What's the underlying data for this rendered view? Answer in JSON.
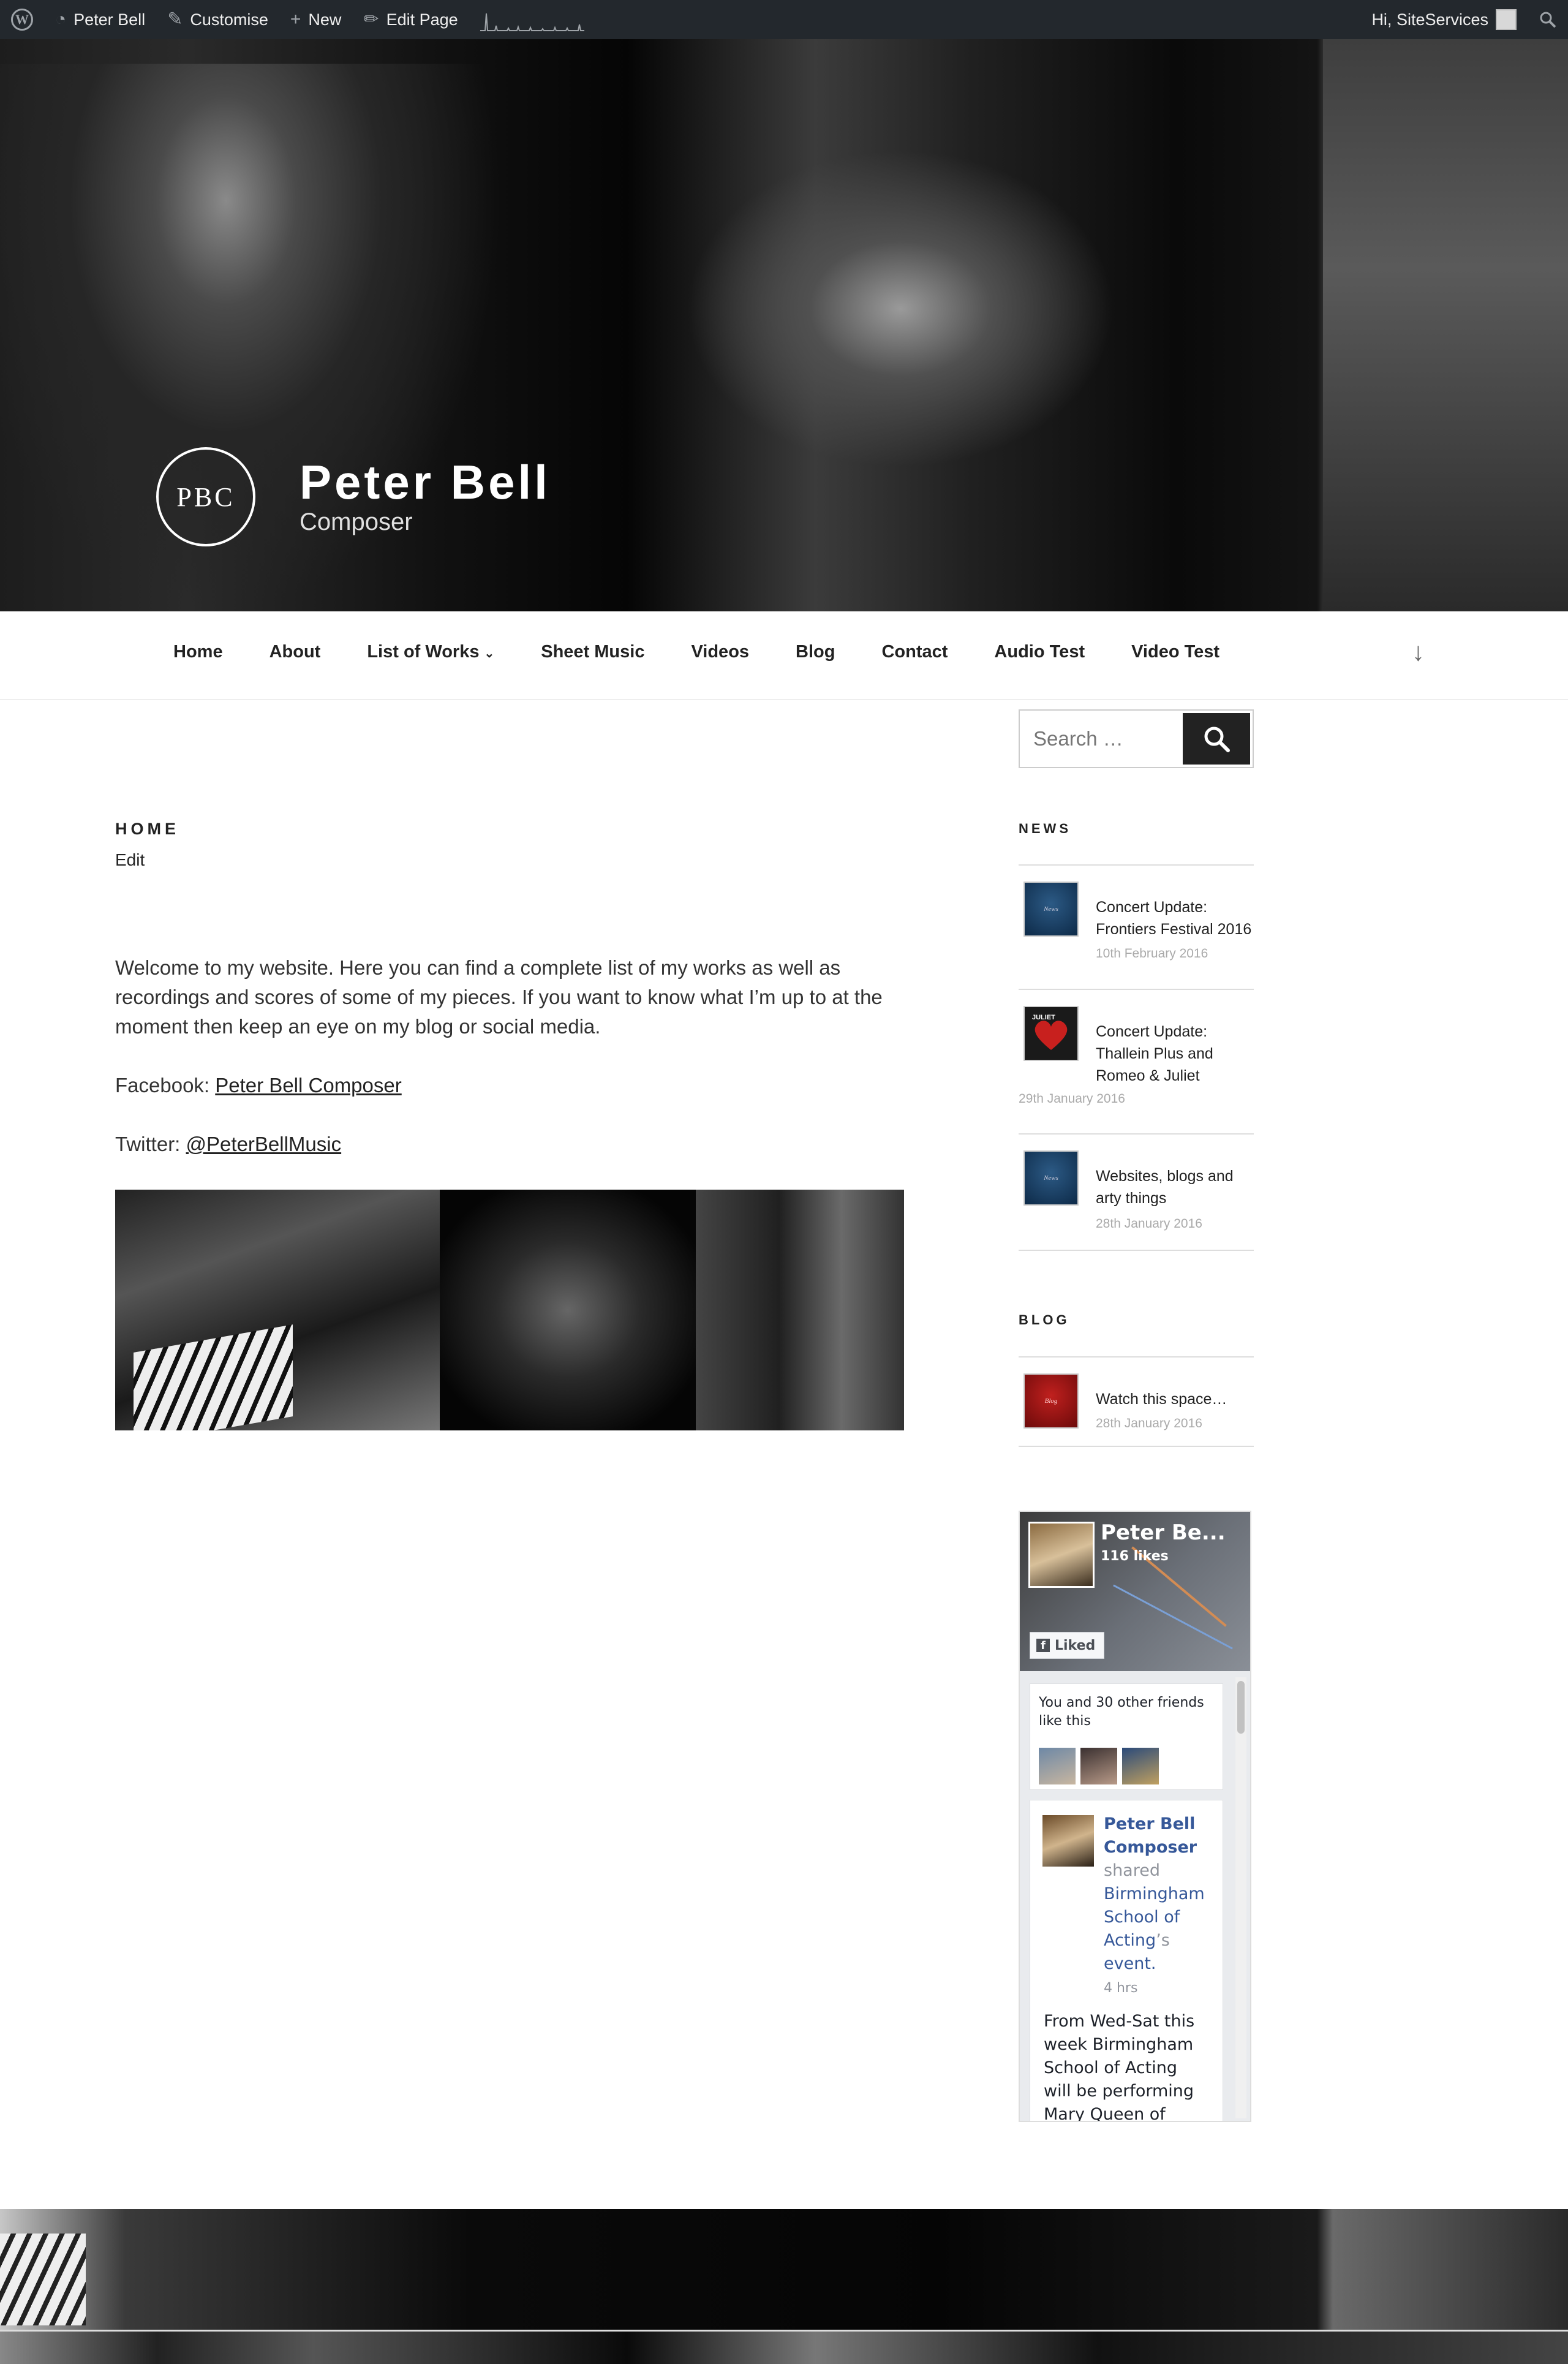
{
  "admin_bar": {
    "site_name": "Peter Bell",
    "customise": "Customise",
    "new": "New",
    "edit_page": "Edit Page",
    "greeting": "Hi, SiteServices"
  },
  "header": {
    "logo_text": "PBC",
    "title": "Peter Bell",
    "description": "Composer"
  },
  "nav": {
    "items": [
      {
        "label": "Home"
      },
      {
        "label": "About"
      },
      {
        "label": "List of Works"
      },
      {
        "label": "Sheet Music"
      },
      {
        "label": "Videos"
      },
      {
        "label": "Blog"
      },
      {
        "label": "Contact"
      },
      {
        "label": "Audio Test"
      },
      {
        "label": "Video Test"
      }
    ]
  },
  "page": {
    "title": "HOME",
    "edit": "Edit",
    "intro": "Welcome to my website. Here you can find a complete list of my works as well as recordings and scores of some of my pieces. If you want to know what I’m up to at the moment then keep an eye on my blog or social media.",
    "facebook_label": "Facebook:",
    "facebook_link": "Peter Bell Composer",
    "twitter_label": "Twitter:",
    "twitter_link": "@PeterBellMusic"
  },
  "sidebar": {
    "search_placeholder": "Search …",
    "news_title": "NEWS",
    "news": [
      {
        "thumb": "News",
        "title": "Concert Update: Frontiers Festival 2016",
        "date": "10th February 2016"
      },
      {
        "thumb": "JULIET",
        "title": "Concert Update: Thallein Plus and Romeo & Juliet",
        "date": "29th January 2016"
      },
      {
        "thumb": "News",
        "title": "Websites, blogs and arty things",
        "date": "28th January 2016"
      }
    ],
    "blog_title": "BLOG",
    "blog": [
      {
        "thumb": "Blog",
        "title": "Watch this space…",
        "date": "28th January 2016"
      }
    ]
  },
  "facebook": {
    "page_name": "Peter Be...",
    "likes": "116 likes",
    "liked": "Liked",
    "friends_text": "You and 30 other friends like this",
    "post_author": "Peter Bell Composer",
    "post_shared": "shared",
    "post_target": "Birmingham School of Acting",
    "post_suffix": "’s",
    "post_event": "event.",
    "post_time": "4 hrs",
    "post_message": "From Wed-Sat this week Birmingham School of Acting will be performing Mary Queen of Scots Got"
  },
  "colors": {
    "admin_bar_bg": "#23282d",
    "fb_link": "#365899",
    "search_button": "#222222"
  }
}
